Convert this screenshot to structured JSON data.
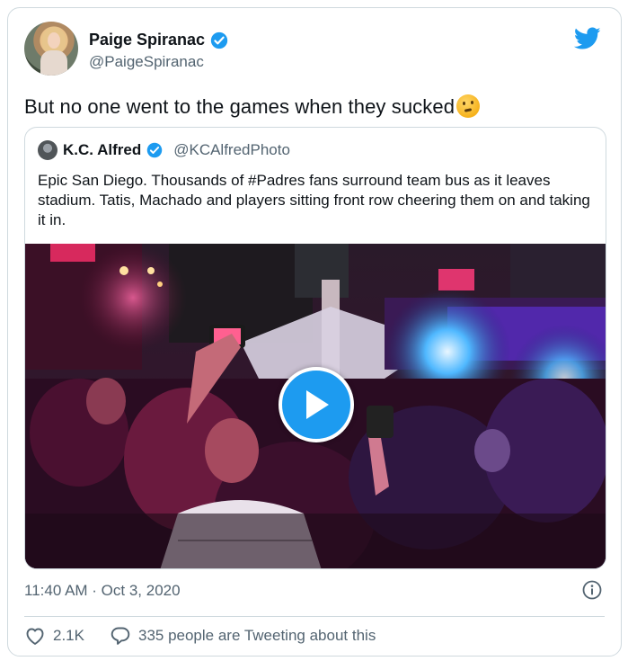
{
  "tweet": {
    "author": {
      "display_name": "Paige Spiranac",
      "handle": "@PaigeSpiranac",
      "verified": true
    },
    "text": "But no one went to the games when they sucked",
    "emoji": "thinking-face",
    "timestamp": "11:40 AM · Oct 3, 2020",
    "likes": "2.1K",
    "tweeting_label": "335 people are Tweeting about this"
  },
  "quoted": {
    "author": {
      "display_name": "K.C. Alfred",
      "handle": "@KCAlfredPhoto",
      "verified": true
    },
    "text": "Epic San Diego. Thousands of #Padres fans surround team bus as it leaves stadium. Tatis, Machado and players sitting front row cheering them on and taking it in."
  },
  "icons": {
    "brand": "twitter-bird-icon",
    "verified": "verified-badge-icon",
    "play": "play-icon",
    "info": "info-icon",
    "like": "heart-icon",
    "reply": "speech-bubble-icon"
  },
  "colors": {
    "accent": "#1d9bf0",
    "text": "#0f1419",
    "secondary": "#536471",
    "border": "#cfd9de"
  }
}
